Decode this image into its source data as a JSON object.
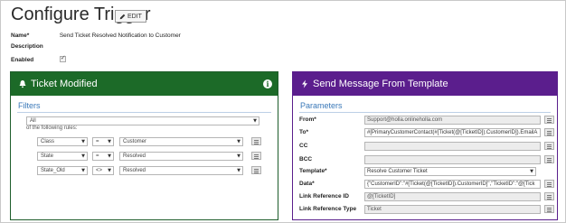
{
  "page": {
    "title": "Configure Trigger",
    "edit_label": "EDIT"
  },
  "meta": {
    "name_label": "Name*",
    "name_value": "Send Ticket Resolved Notification to Customer",
    "description_label": "Description",
    "enabled_label": "Enabled",
    "enabled": true
  },
  "left_panel": {
    "title": "Ticket Modified",
    "header_color": "#1c6a28",
    "section_title": "Filters",
    "match_select": "All",
    "rules_text": "of the following rules:",
    "rules": [
      {
        "field": "Class",
        "operator": "=",
        "value": "Customer"
      },
      {
        "field": "State",
        "operator": "=",
        "value": "Resolved"
      },
      {
        "field": "State_Old",
        "operator": "<>",
        "value": "Resolved"
      }
    ]
  },
  "right_panel": {
    "title": "Send Message From Template",
    "header_color": "#5b1e8d",
    "section_title": "Parameters",
    "fields": [
      {
        "label": "From*",
        "value": "Support@holla.onlineholla.com",
        "disabled": true
      },
      {
        "label": "To*",
        "value": "#[PrimaryCustomerContact(#[Ticket(@[TicketID]).CustomerID]).EmailA",
        "disabled": false
      },
      {
        "label": "CC",
        "value": "",
        "disabled": true
      },
      {
        "label": "BCC",
        "value": "",
        "disabled": true
      },
      {
        "label": "Template*",
        "value": "Resolve Customer Ticket",
        "disabled": false,
        "select": true
      },
      {
        "label": "Data*",
        "value": "{\"CustomerID\":\"#[Ticket(@[TicketID]).CustomerID]\",\"TicketID\":\"@[Tick",
        "disabled": false
      },
      {
        "label": "Link Reference ID",
        "value": "@[TicketID]",
        "disabled": true
      },
      {
        "label": "Link Reference Type",
        "value": "Ticket",
        "disabled": true
      }
    ]
  }
}
